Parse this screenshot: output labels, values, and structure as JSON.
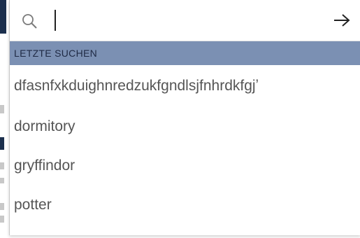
{
  "search": {
    "value": "",
    "placeholder": ""
  },
  "icons": {
    "search": "search-icon",
    "submit": "arrow-right-icon"
  },
  "recent_searches": {
    "header": "LETZTE SUCHEN",
    "items": [
      {
        "label": "dfasnfxkduighnredzukfgndlsjfnhrdkfgjʼ"
      },
      {
        "label": "dormitory"
      },
      {
        "label": "gryffindor"
      },
      {
        "label": "potter"
      }
    ]
  },
  "colors": {
    "header_background": "#7b90b3",
    "header_text": "#1f2a44",
    "item_text": "#555555",
    "left_band": "#1b2f4d"
  }
}
